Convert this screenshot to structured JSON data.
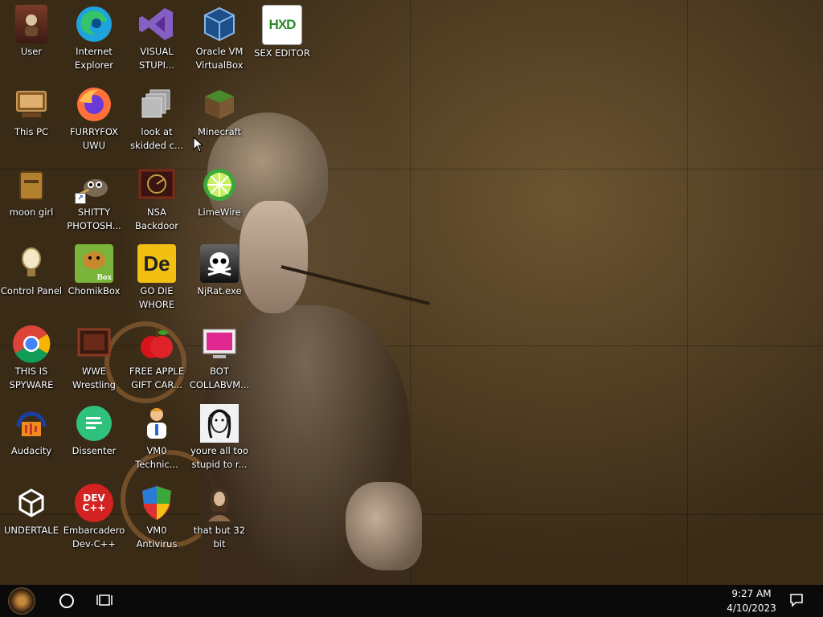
{
  "desktop": {
    "icons": [
      {
        "label": "User",
        "icon": "user-folder-icon"
      },
      {
        "label": "Internet Explorer",
        "icon": "edge-browser-icon"
      },
      {
        "label": "VISUAL STUPI...",
        "icon": "visual-studio-icon"
      },
      {
        "label": "Oracle VM VirtualBox",
        "icon": "virtualbox-icon"
      },
      {
        "label": "SEX EDITOR",
        "icon": "hxd-editor-icon",
        "icon_text": "HXD"
      },
      {
        "label": "This PC",
        "icon": "computer-icon"
      },
      {
        "label": "FURRYFOX UWU",
        "icon": "firefox-icon"
      },
      {
        "label": "look at skidded c...",
        "icon": "copies-icon"
      },
      {
        "label": "Minecraft",
        "icon": "minecraft-grass-block-icon"
      },
      {
        "label": "moon girl",
        "icon": "folder-icon"
      },
      {
        "label": "SHITTY PHOTOSH...",
        "icon": "gimp-icon"
      },
      {
        "label": "NSA Backdoor",
        "icon": "radar-screen-icon"
      },
      {
        "label": "LimeWire",
        "icon": "limewire-icon"
      },
      {
        "label": "Control Panel",
        "icon": "lightbulb-icon"
      },
      {
        "label": "ChomikBox",
        "icon": "chomikbox-icon",
        "icon_text": "Box"
      },
      {
        "label": "GO DIE WHORE",
        "icon": "de-icon",
        "icon_text": "De"
      },
      {
        "label": "NjRat.exe",
        "icon": "skull-icon"
      },
      {
        "label": "THIS IS SPYWARE",
        "icon": "chrome-icon"
      },
      {
        "label": "WWE Wrestling",
        "icon": "tv-monitor-icon"
      },
      {
        "label": "FREE APPLE GIFT CAR...",
        "icon": "red-apple-icon"
      },
      {
        "label": "BOT COLLABVM...",
        "icon": "monitor-pink-icon"
      },
      {
        "label": "Audacity",
        "icon": "audacity-icon"
      },
      {
        "label": "Dissenter",
        "icon": "chat-bubble-icon"
      },
      {
        "label": "VM0 Technic...",
        "icon": "technician-person-icon"
      },
      {
        "label": "youre all too stupid to r...",
        "icon": "portrait-sketch-icon"
      },
      {
        "label": "UNDERTALE",
        "icon": "unity-icon"
      },
      {
        "label": "Embarcadero Dev-C++",
        "icon": "devcpp-icon",
        "icon_text": "DEV C++"
      },
      {
        "label": "VM0 Antivirus",
        "icon": "security-shield-icon"
      },
      {
        "label": "that but 32 bit",
        "icon": "portrait-painting-icon"
      }
    ]
  },
  "taskbar": {
    "start": "start-button",
    "search": "cortana-circle-icon",
    "task_view": "task-view-icon",
    "clock": {
      "time": "9:27 AM",
      "date": "4/10/2023"
    },
    "notifications": "action-center-icon"
  }
}
